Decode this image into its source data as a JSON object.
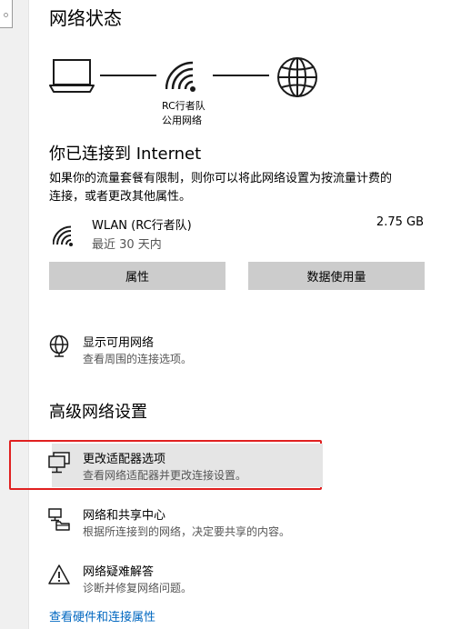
{
  "page": {
    "title": "网络状态"
  },
  "network": {
    "name": "RC行者队",
    "type": "公用网络"
  },
  "status": {
    "heading": "你已连接到 Internet",
    "desc_line1": "如果你的流量套餐有限制，则你可以将此网络设置为按流量计费的",
    "desc_line2": "连接，或者更改其他属性。"
  },
  "connection": {
    "name": "WLAN (RC行者队)",
    "period": "最近 30 天内",
    "usage": "2.75 GB"
  },
  "buttons": {
    "properties": "属性",
    "data_usage": "数据使用量"
  },
  "options": {
    "show_networks": {
      "title": "显示可用网络",
      "subtitle": "查看周围的连接选项。"
    }
  },
  "advanced": {
    "heading": "高级网络设置",
    "items": [
      {
        "title": "更改适配器选项",
        "subtitle": "查看网络适配器并更改连接设置。"
      },
      {
        "title": "网络和共享中心",
        "subtitle": "根据所连接到的网络，决定要共享的内容。"
      },
      {
        "title": "网络疑难解答",
        "subtitle": "诊断并修复网络问题。"
      }
    ]
  },
  "links": {
    "hardware": "查看硬件和连接属性"
  },
  "colors": {
    "highlight_border": "#e02020",
    "link": "#0067c0",
    "button_bg": "#cccccc"
  },
  "icons": {
    "laptop": "laptop-icon",
    "wifi": "wifi-icon",
    "globe": "globe-icon",
    "adapter": "adapter-icon",
    "sharing": "sharing-center-icon",
    "troubleshoot": "warning-icon"
  }
}
